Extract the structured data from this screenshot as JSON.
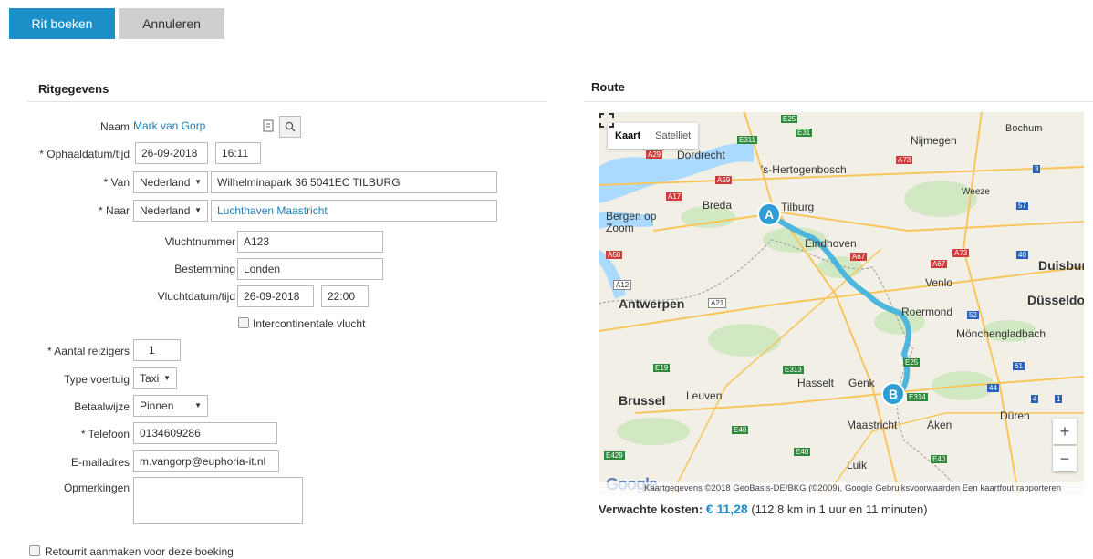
{
  "toolbar": {
    "book_label": "Rit boeken",
    "cancel_label": "Annuleren"
  },
  "ride": {
    "title": "Ritgegevens",
    "name": {
      "label": "Naam",
      "value": "Mark van Gorp"
    },
    "pickup": {
      "label": "* Ophaaldatum/tijd",
      "date": "26-09-2018",
      "time": "16:11"
    },
    "from": {
      "label": "* Van",
      "country": "Nederland",
      "address": "Wilhelminapark 36 5041EC TILBURG"
    },
    "to": {
      "label": "* Naar",
      "country": "Nederland",
      "address": "Luchthaven Maastricht"
    },
    "flight_number": {
      "label": "Vluchtnummer",
      "value": "A123"
    },
    "destination": {
      "label": "Bestemming",
      "value": "Londen"
    },
    "flight_datetime": {
      "label": "Vluchtdatum/tijd",
      "date": "26-09-2018",
      "time": "22:00"
    },
    "intercontinental": {
      "label": "Intercontinentale vlucht",
      "checked": false
    },
    "travelers": {
      "label": "* Aantal reizigers",
      "value": "1"
    },
    "vehicle": {
      "label": "Type voertuig",
      "value": "Taxi"
    },
    "payment": {
      "label": "Betaalwijze",
      "value": "Pinnen"
    },
    "phone": {
      "label": "* Telefoon",
      "value": "0134609286"
    },
    "email": {
      "label": "E-mailadres",
      "value": "m.vangorp@euphoria-it.nl"
    },
    "remarks": {
      "label": "Opmerkingen",
      "value": ""
    },
    "return_trip": {
      "label": "Retourrit aanmaken voor deze boeking",
      "checked": false
    }
  },
  "route": {
    "title": "Route",
    "map": {
      "tab_map": "Kaart",
      "tab_satellite": "Satelliet",
      "zoom_in": "+",
      "zoom_out": "−",
      "attribution": "Kaartgegevens ©2018 GeoBasis-DE/BKG (©2009), Google   Gebruiksvoorwaarden   Een kaartfout rapporteren",
      "logo": "Google",
      "marker_a": "A",
      "marker_b": "B",
      "cities": [
        "Nijmegen",
        "Dordrecht",
        "'s-Hertogenbosch",
        "Breda",
        "Tilburg",
        "Weeze",
        "Bergen op Zoom",
        "Eindhoven",
        "Venlo",
        "Duisburg",
        "Antwerpen",
        "Roermond",
        "Düsseldorf",
        "Mönchengladbach",
        "Hasselt",
        "Genk",
        "Brussel",
        "Leuven",
        "Maastricht",
        "Aken",
        "Düren",
        "Luik",
        "Bochum"
      ],
      "road_labels": [
        "E25",
        "E31",
        "E311",
        "A29",
        "A59",
        "A73",
        "A17",
        "A58",
        "A12",
        "A21",
        "A67",
        "A73",
        "A67",
        "40",
        "57",
        "3",
        "52",
        "E19",
        "E313",
        "E314",
        "E40",
        "E40",
        "E40",
        "E429",
        "E25",
        "61",
        "44",
        "4",
        "1"
      ]
    },
    "cost_label": "Verwachte kosten:",
    "cost_amount": "€ 11,28",
    "cost_detail": "(112,8 km in 1 uur en 11 minuten)"
  },
  "colors": {
    "primary": "#1d8fc8",
    "route_line": "#4cb6dc",
    "link_text": "#1d7fb8"
  }
}
